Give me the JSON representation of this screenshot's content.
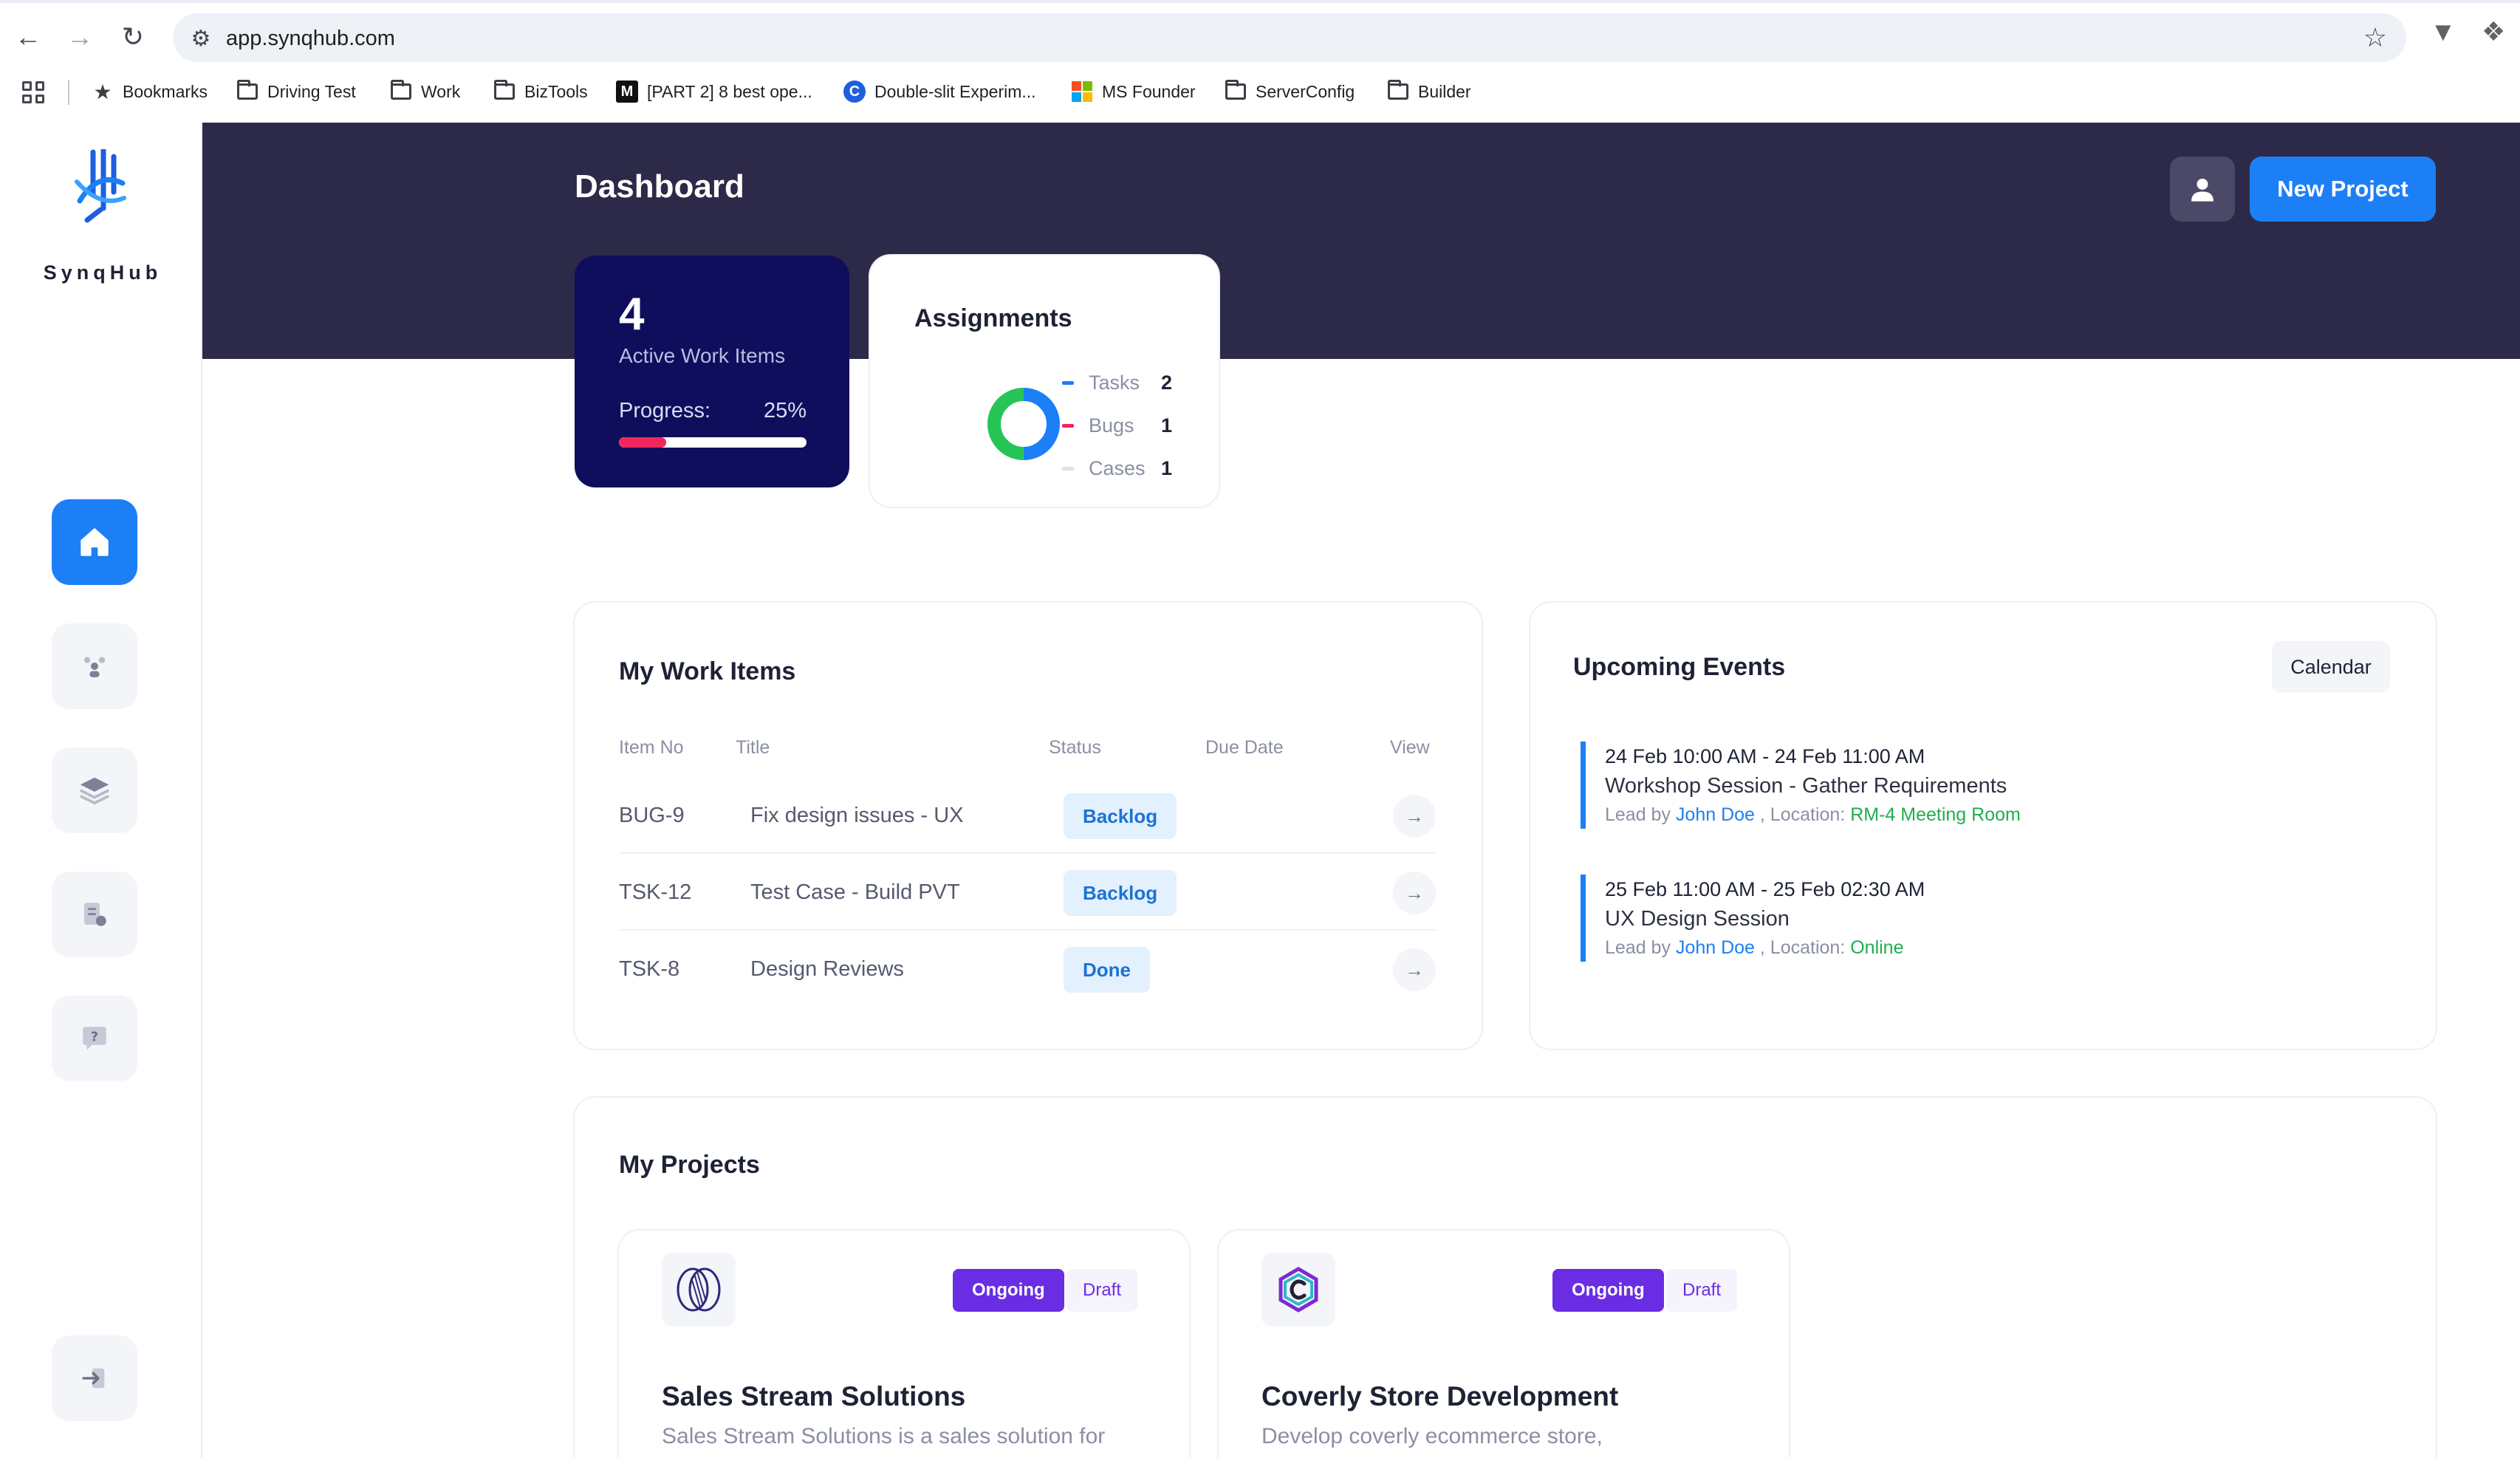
{
  "browser": {
    "url": "app.synqhub.com",
    "bookmarks": [
      {
        "label": "Bookmarks",
        "icon": "star-icon"
      },
      {
        "label": "Driving Test",
        "icon": "folder-icon"
      },
      {
        "label": "Work",
        "icon": "folder-icon"
      },
      {
        "label": "BizTools",
        "icon": "folder-icon"
      },
      {
        "label": "[PART 2] 8 best ope...",
        "icon": "medium-logo-icon"
      },
      {
        "label": "Double-slit Experim...",
        "icon": "site-logo-icon"
      },
      {
        "label": "MS Founder",
        "icon": "microsoft-logo-icon"
      },
      {
        "label": "ServerConfig",
        "icon": "folder-icon"
      },
      {
        "label": "Builder",
        "icon": "folder-icon"
      }
    ]
  },
  "sidebar": {
    "brand": "SynqHub",
    "items": [
      {
        "name": "home",
        "icon": "home-icon",
        "active": true
      },
      {
        "name": "team",
        "icon": "team-icon",
        "active": false
      },
      {
        "name": "projects",
        "icon": "layers-icon",
        "active": false
      },
      {
        "name": "documents",
        "icon": "document-icon",
        "active": false
      },
      {
        "name": "help",
        "icon": "help-chat-icon",
        "active": false
      }
    ],
    "logout_icon": "logout-icon"
  },
  "header": {
    "title": "Dashboard",
    "new_project_label": "New Project"
  },
  "stats": {
    "active_count": "4",
    "active_label": "Active Work Items",
    "progress_label": "Progress:",
    "progress_text": "25%",
    "progress_value": 25
  },
  "assignments": {
    "title": "Assignments",
    "items": [
      {
        "label": "Tasks",
        "count": "2",
        "color": "#1c7ff5"
      },
      {
        "label": "Bugs",
        "count": "1",
        "color": "#f0275b"
      },
      {
        "label": "Cases",
        "count": "1",
        "color": "#dfe2ea"
      }
    ],
    "donut_colors": [
      "#1c7ff5",
      "#26c456",
      "#e6e8f0"
    ]
  },
  "work_items": {
    "title": "My Work Items",
    "columns": [
      "Item No",
      "Title",
      "Status",
      "Due Date",
      "View"
    ],
    "rows": [
      {
        "no": "BUG-9",
        "title": "Fix design issues - UX",
        "status": "Backlog",
        "due": ""
      },
      {
        "no": "TSK-12",
        "title": "Test Case - Build PVT",
        "status": "Backlog",
        "due": ""
      },
      {
        "no": "TSK-8",
        "title": "Design Reviews",
        "status": "Done",
        "due": ""
      }
    ]
  },
  "events": {
    "title": "Upcoming Events",
    "calendar_label": "Calendar",
    "items": [
      {
        "when": "24 Feb 10:00 AM - 24 Feb 11:00 AM",
        "what": "Workshop Session - Gather Requirements",
        "lead_prefix": "Lead by",
        "lead": "John Doe",
        "loc_prefix": ", Location:",
        "location": "RM-4 Meeting Room"
      },
      {
        "when": "25 Feb 11:00 AM - 25 Feb 02:30 AM",
        "what": "UX Design Session",
        "lead_prefix": "Lead by",
        "lead": "John Doe",
        "loc_prefix": ", Location:",
        "location": "Online"
      }
    ]
  },
  "projects": {
    "title": "My Projects",
    "items": [
      {
        "name": "Sales Stream Solutions",
        "desc": "Sales Stream Solutions is a sales solution for",
        "tag1": "Ongoing",
        "tag2": "Draft"
      },
      {
        "name": "Coverly Store Development",
        "desc": "Develop coverly ecommerce store,",
        "tag1": "Ongoing",
        "tag2": "Draft"
      }
    ]
  }
}
